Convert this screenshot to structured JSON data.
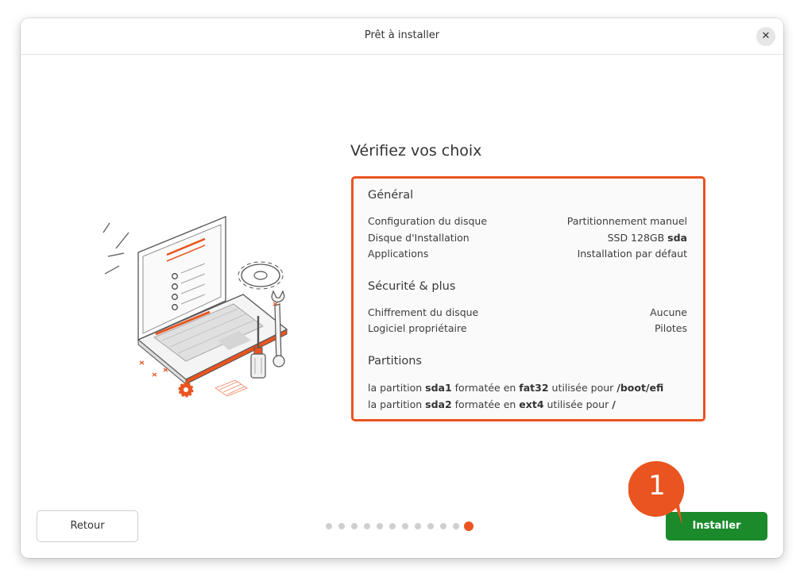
{
  "window": {
    "title": "Prêt à installer",
    "close_glyph": "✕"
  },
  "heading": "Vérifiez vos choix",
  "summary": {
    "general": {
      "title": "Général",
      "rows": [
        {
          "label": "Configuration du disque",
          "value": "Partitionnement manuel"
        },
        {
          "label": "Disque d'Installation",
          "value": "SSD 128GB",
          "value_bold": "sda"
        },
        {
          "label": "Applications",
          "value": "Installation par défaut"
        }
      ]
    },
    "security": {
      "title": "Sécurité & plus",
      "rows": [
        {
          "label": "Chiffrement du disque",
          "value": "Aucune"
        },
        {
          "label": "Logiciel propriétaire",
          "value": "Pilotes"
        }
      ]
    },
    "partitions": {
      "title": "Partitions",
      "lines": [
        {
          "t1": "la partition ",
          "part": "sda1",
          "t2": " formatée en ",
          "fs": "fat32",
          "t3": " utilisée pour ",
          "mount": "/boot/efi"
        },
        {
          "t1": "la partition ",
          "part": "sda2",
          "t2": " formatée en ",
          "fs": "ext4",
          "t3": " utilisée pour ",
          "mount": "/"
        }
      ]
    },
    "border_color": "#e95420"
  },
  "footer": {
    "back_label": "Retour",
    "install_label": "Installer",
    "install_color": "#1a8a2b",
    "steps_total": 12,
    "current_step": 12
  },
  "annotation": {
    "number": "1",
    "color": "#e95420"
  }
}
